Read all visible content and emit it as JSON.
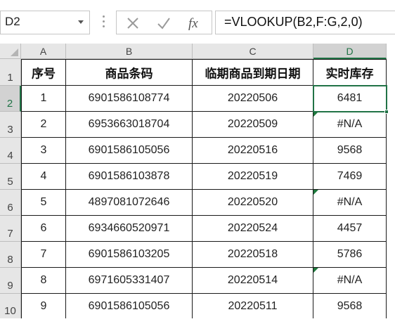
{
  "name_box": {
    "value": "D2"
  },
  "formula_bar": {
    "cancel_icon": "close-icon",
    "enter_icon": "check-icon",
    "fx_label": "fx",
    "formula": "=VLOOKUP(B2,F:G,2,0)"
  },
  "columns": [
    "A",
    "B",
    "C",
    "D"
  ],
  "rows": [
    "1",
    "2",
    "3",
    "4",
    "5",
    "6",
    "7",
    "8",
    "9",
    "10"
  ],
  "header": [
    "序号",
    "商品条码",
    "临期商品到期日期",
    "实时库存"
  ],
  "data": [
    [
      "1",
      "6901586108774",
      "20220506",
      "6481"
    ],
    [
      "2",
      "6953663018704",
      "20220509",
      "#N/A"
    ],
    [
      "3",
      "6901586105056",
      "20220516",
      "9568"
    ],
    [
      "4",
      "6901586103878",
      "20220519",
      "7469"
    ],
    [
      "5",
      "4897081072646",
      "20220520",
      "#N/A"
    ],
    [
      "6",
      "6934660520971",
      "20220524",
      "4457"
    ],
    [
      "7",
      "6901586103205",
      "20220518",
      "5786"
    ],
    [
      "8",
      "6971605331407",
      "20220514",
      "#N/A"
    ],
    [
      "9",
      "6901586105056",
      "20220511",
      "9568"
    ]
  ],
  "colors": {
    "accent": "#217346",
    "error_flag": "#1e7a3d"
  }
}
